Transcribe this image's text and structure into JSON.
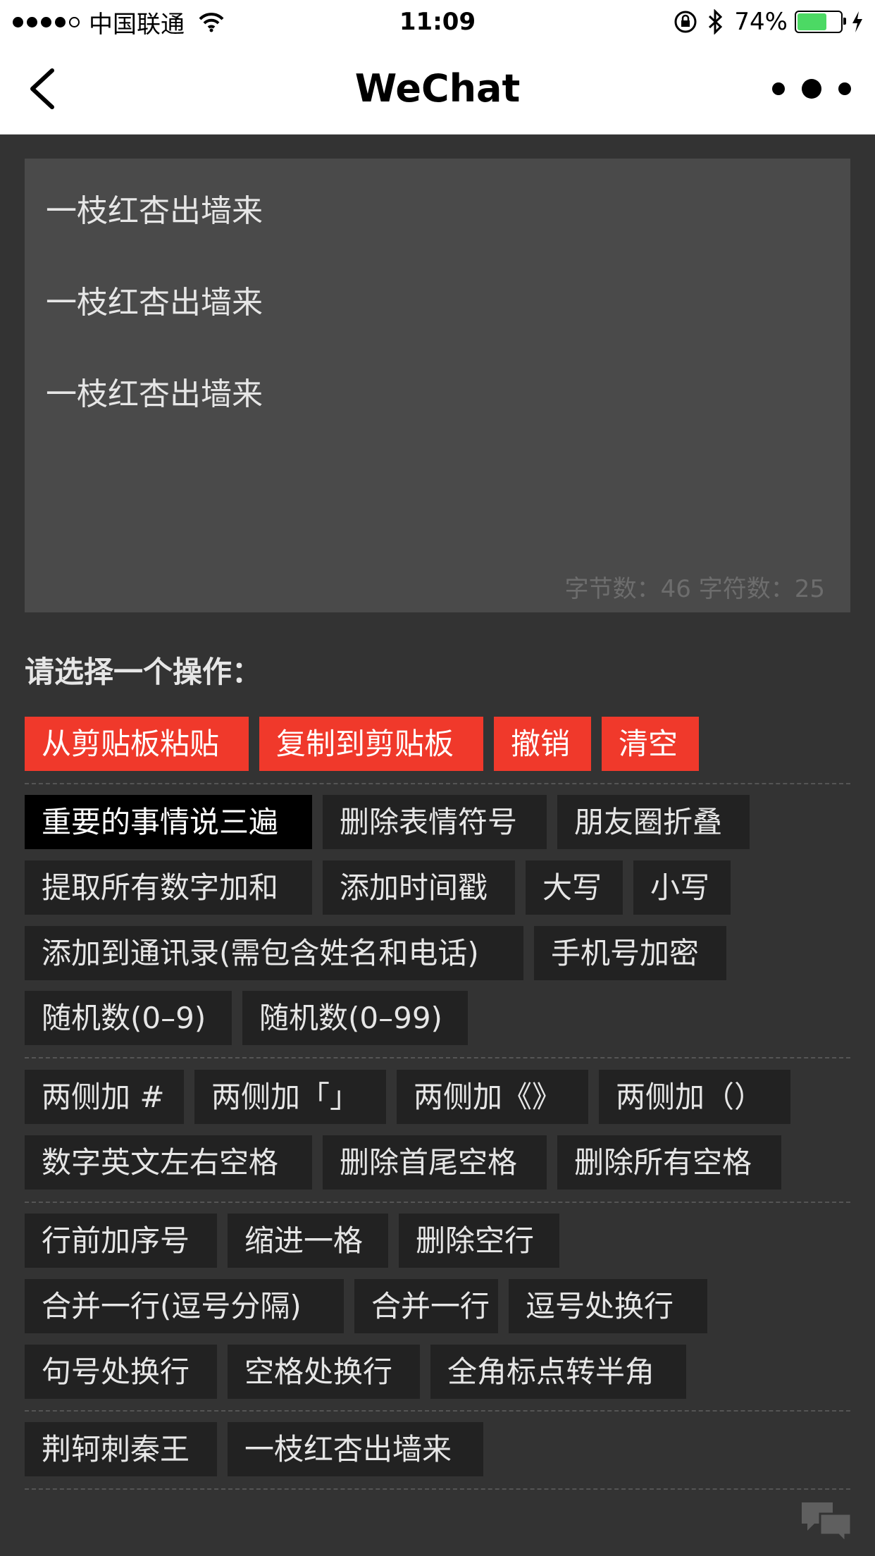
{
  "status_bar": {
    "carrier": "中国联通",
    "time": "11:09",
    "battery_percent": "74%",
    "battery_level": 0.74,
    "battery_color": "#4cd964",
    "icons": [
      "signal-dots-icon",
      "wifi-icon",
      "rotation-lock-icon",
      "bluetooth-icon",
      "battery-icon",
      "charging-icon"
    ]
  },
  "nav": {
    "title": "WeChat",
    "back_icon": "chevron-left-icon",
    "more_icon": "more-dots-icon"
  },
  "editor": {
    "lines": [
      "一枝红杏出墙来",
      "一枝红杏出墙来",
      "一枝红杏出墙来"
    ],
    "counter": "字节数：46  字符数：25"
  },
  "section_label": "请选择一个操作：",
  "actions": {
    "red": [
      "从剪贴板粘贴",
      "复制到剪贴板",
      "撤销",
      "清空"
    ],
    "group1": [
      "重要的事情说三遍",
      "删除表情符号",
      "朋友圈折叠",
      "提取所有数字加和",
      "添加时间戳",
      "大写",
      "小写",
      "添加到通讯录(需包含姓名和电话)",
      "手机号加密",
      "随机数(0–9)",
      "随机数(0–99)"
    ],
    "group2": [
      "两侧加 #",
      "两侧加「」",
      "两侧加《》",
      "两侧加（）",
      "数字英文左右空格",
      "删除首尾空格",
      "删除所有空格"
    ],
    "group3": [
      "行前加序号",
      "缩进一格",
      "删除空行",
      "合并一行(逗号分隔)",
      "合并一行",
      "逗号处换行",
      "句号处换行",
      "空格处换行",
      "全角标点转半角"
    ],
    "group4": [
      "荆轲刺秦王",
      "一枝红杏出墙来"
    ]
  },
  "colors": {
    "background": "#333333",
    "editor_bg": "#4a4a4a",
    "button_bg": "#222222",
    "accent_red": "#f0392b",
    "selected_bg": "#000000"
  },
  "fab_icon": "chat-bubbles-icon"
}
